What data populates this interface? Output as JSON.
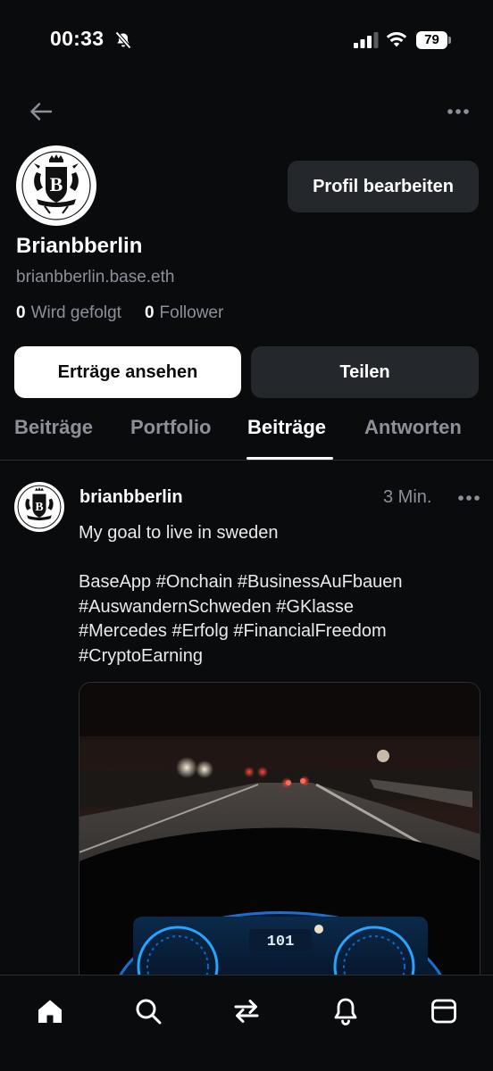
{
  "status_bar": {
    "time": "00:33",
    "battery": "79"
  },
  "header": {
    "back_icon": "arrow-left-icon",
    "more_icon": "more-horizontal-icon"
  },
  "profile": {
    "edit_label": "Profil bearbeiten",
    "display_name": "Brianbberlin",
    "handle": "brianbberlin.base.eth",
    "following_count": "0",
    "following_label": "Wird gefolgt",
    "followers_count": "0",
    "followers_label": "Follower",
    "earnings_label": "Erträge ansehen",
    "share_label": "Teilen"
  },
  "tabs": [
    {
      "label": "Beiträge",
      "active": false
    },
    {
      "label": "Portfolio",
      "active": false
    },
    {
      "label": "Beiträge",
      "active": true
    },
    {
      "label": "Antworten",
      "active": false
    }
  ],
  "post": {
    "username": "brianbberlin",
    "time": "3 Min.",
    "lines": [
      "My goal to live in sweden",
      "",
      "BaseApp #Onchain #BusinessAuFbauen",
      "#AuswandernSchweden #GKlasse",
      "#Mercedes #Erfolg #FinancialFreedom",
      "#CryptoEarning"
    ],
    "dash_speed": "101"
  },
  "bottom_nav": [
    {
      "icon": "home-icon",
      "active": true
    },
    {
      "icon": "search-icon",
      "active": false
    },
    {
      "icon": "swap-icon",
      "active": false
    },
    {
      "icon": "bell-icon",
      "active": false
    },
    {
      "icon": "wallet-icon",
      "active": false
    }
  ],
  "colors": {
    "background": "#0a0b0d",
    "secondary_text": "#8b909a",
    "button_dark": "#24272c",
    "button_light": "#ffffff"
  }
}
